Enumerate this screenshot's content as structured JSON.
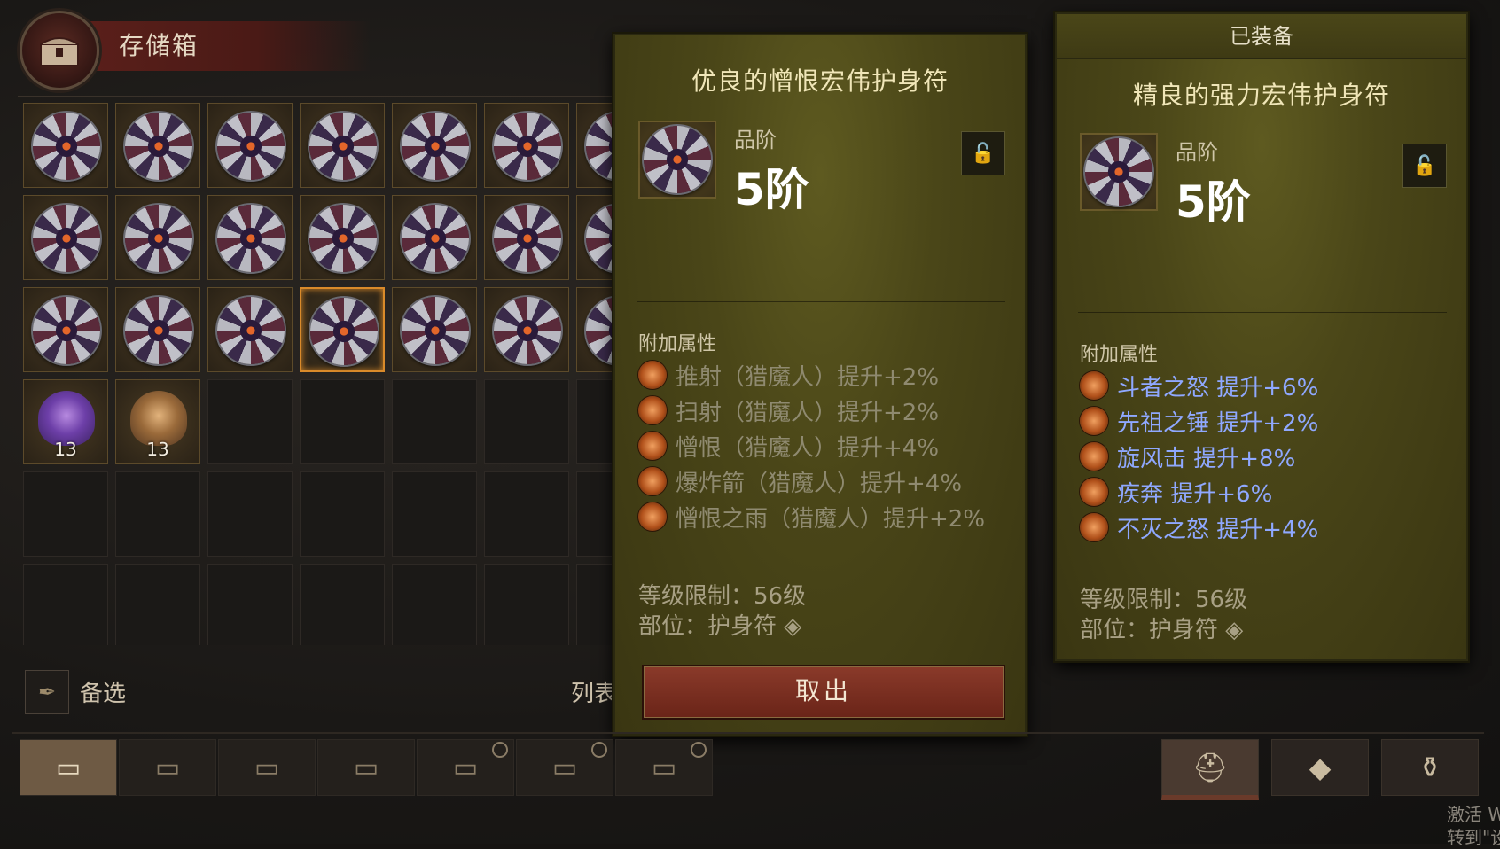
{
  "stash": {
    "title": "存储箱",
    "reserve_label": "备选",
    "list_label": "列表"
  },
  "grid": {
    "rows": [
      [
        "amulet",
        "amulet",
        "amulet",
        "amulet",
        "amulet",
        "amulet",
        "amulet"
      ],
      [
        "amulet",
        "amulet",
        "amulet",
        "amulet",
        "amulet",
        "amulet",
        "amulet"
      ],
      [
        "amulet",
        "amulet",
        "amulet",
        "amulet-selected",
        "amulet",
        "amulet",
        "amulet"
      ],
      [
        "gem-purple",
        "gem-bronze",
        "empty",
        "empty",
        "empty",
        "empty",
        "empty"
      ],
      [
        "empty",
        "empty",
        "empty",
        "empty",
        "empty",
        "empty",
        "empty"
      ],
      [
        "empty",
        "empty",
        "empty",
        "empty",
        "empty",
        "empty",
        "empty"
      ]
    ],
    "stack_counts": {
      "gem-purple": "13",
      "gem-bronze": "13"
    }
  },
  "tooltip_selected": {
    "name": "优良的憎恨宏伟护身符",
    "tier_label": "品阶",
    "tier_value": "5阶",
    "affix_header": "附加属性",
    "affixes": [
      "推射（猎魔人）提升+2%",
      "扫射（猎魔人）提升+2%",
      "憎恨（猎魔人）提升+4%",
      "爆炸箭（猎魔人）提升+4%",
      "憎恨之雨（猎魔人）提升+2%"
    ],
    "level_req": "等级限制：56级",
    "slot": "部位：护身符",
    "withdraw_label": "取出"
  },
  "tooltip_equipped": {
    "header": "已装备",
    "name": "精良的强力宏伟护身符",
    "tier_label": "品阶",
    "tier_value": "5阶",
    "affix_header": "附加属性",
    "affixes": [
      "斗者之怒  提升+6%",
      "先祖之锤  提升+2%",
      "旋风击  提升+8%",
      "疾奔  提升+6%",
      "不灭之怒  提升+4%"
    ],
    "level_req": "等级限制：56级",
    "slot": "部位：护身符"
  },
  "tabs": {
    "stash_tabs": [
      "chest-1",
      "chest-2",
      "chest-3",
      "chest-4",
      "chest-timed-5",
      "chest-timed-6",
      "chest-timed-7"
    ],
    "active_index": 0,
    "right_tabs": [
      "helmet",
      "gem-pile",
      "bag"
    ]
  },
  "watermark": {
    "line1": "激活 W",
    "line2": "转到\"设置"
  },
  "colors": {
    "panel": "#4a4618",
    "affix_grey": "#8f8a70",
    "affix_blue": "#8fa8ff",
    "selected_border": "#d98a2a",
    "withdraw_button": "#7a2e20"
  }
}
